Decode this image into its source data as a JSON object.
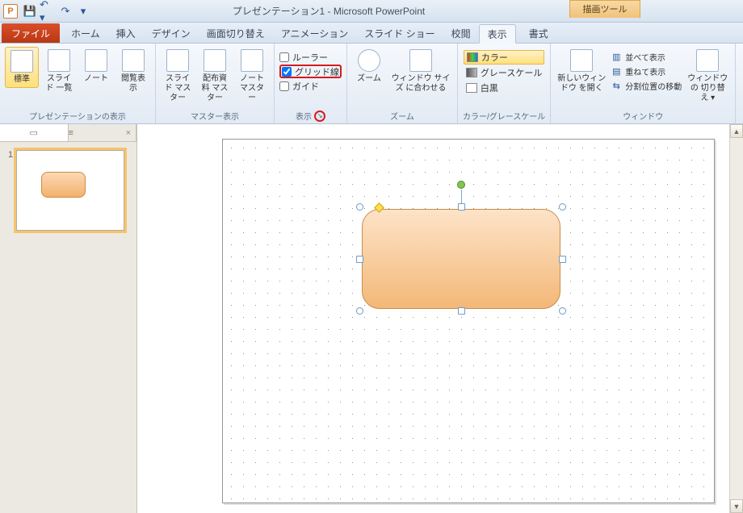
{
  "title": "プレゼンテーション1 - Microsoft PowerPoint",
  "context_tab": "描画ツール",
  "tabs": {
    "file": "ファイル",
    "home": "ホーム",
    "insert": "挿入",
    "design": "デザイン",
    "transitions": "画面切り替え",
    "animations": "アニメーション",
    "slideshow": "スライド ショー",
    "review": "校閲",
    "view": "表示",
    "format": "書式"
  },
  "groups": {
    "pres_views": {
      "label": "プレゼンテーションの表示",
      "normal": "標準",
      "sorter": "スライド\n一覧",
      "notes": "ノート",
      "reading": "閲覧表示"
    },
    "master_views": {
      "label": "マスター表示",
      "slide": "スライド\nマスター",
      "handout": "配布資料\nマスター",
      "notes": "ノート\nマスター"
    },
    "show": {
      "label": "表示",
      "ruler": "ルーラー",
      "gridlines": "グリッド線",
      "guides": "ガイド",
      "ruler_checked": false,
      "gridlines_checked": true,
      "guides_checked": false
    },
    "zoom": {
      "label": "ズーム",
      "zoom": "ズーム",
      "fit": "ウィンドウ サイズ\nに合わせる"
    },
    "colorgray": {
      "label": "カラー/グレースケール",
      "color": "カラー",
      "gray": "グレースケール",
      "bw": "白黒"
    },
    "window": {
      "label": "ウィンドウ",
      "new": "新しいウィンドウ\nを開く",
      "arrange": "並べて表示",
      "cascade": "重ねて表示",
      "split": "分割位置の移動",
      "switch": "ウィンドウの\n切り替え ▾"
    }
  },
  "thumbs": {
    "slide_no": "1"
  }
}
